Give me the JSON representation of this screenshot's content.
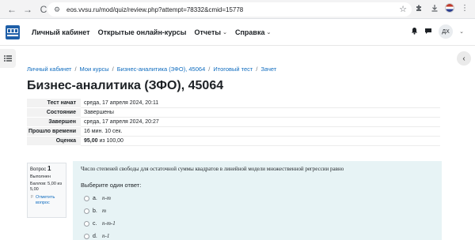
{
  "browser": {
    "url": "eos.vvsu.ru/mod/quiz/review.php?attempt=78332&cmid=15778",
    "back_icon": "←",
    "forward_icon": "→",
    "reload_icon": "C",
    "star_icon": "☆"
  },
  "header": {
    "nav": [
      {
        "label": "Личный кабинет",
        "caret": ""
      },
      {
        "label": "Открытые онлайн-курсы",
        "caret": ""
      },
      {
        "label": "Отчеты",
        "caret": "⌄"
      },
      {
        "label": "Справка",
        "caret": "⌄"
      }
    ],
    "user_initials": "ДХ"
  },
  "breadcrumb": [
    "Личный кабинет",
    "Мои курсы",
    "Бизнес-аналитика (ЗФО), 45064",
    "Итоговый тест",
    "Зачет"
  ],
  "page_title": "Бизнес-аналитика (ЗФО), 45064",
  "summary": [
    {
      "label": "Тест начат",
      "value": "среда, 17 апреля 2024, 20:11"
    },
    {
      "label": "Состояние",
      "value": "Завершены"
    },
    {
      "label": "Завершен",
      "value": "среда, 17 апреля 2024, 20:27"
    },
    {
      "label": "Прошло времени",
      "value": "16 мин. 10 сек."
    }
  ],
  "grade_row": {
    "label": "Оценка",
    "value_bold": "95,00",
    "value_rest": " из 100,00"
  },
  "question_info": {
    "prefix": "Вопрос",
    "number": "1",
    "state": "Выполнен",
    "grade": "Баллов: 5,00 из 5,00",
    "flag_label": "Отметить вопрос"
  },
  "question": {
    "text": "Число степеней свободы для остаточной суммы квадратов в линейной модели множественной регрессии равно",
    "prompt": "Выберите один ответ:",
    "answers": [
      {
        "letter": "a.",
        "text": "n-m"
      },
      {
        "letter": "b.",
        "text": "m"
      },
      {
        "letter": "c.",
        "text": "n-m-1"
      },
      {
        "letter": "d.",
        "text": "n-1"
      }
    ]
  },
  "colors": {
    "link": "#0f6cbf",
    "question_bg": "#e7f3f5",
    "label_bg": "#f2f2f2"
  }
}
